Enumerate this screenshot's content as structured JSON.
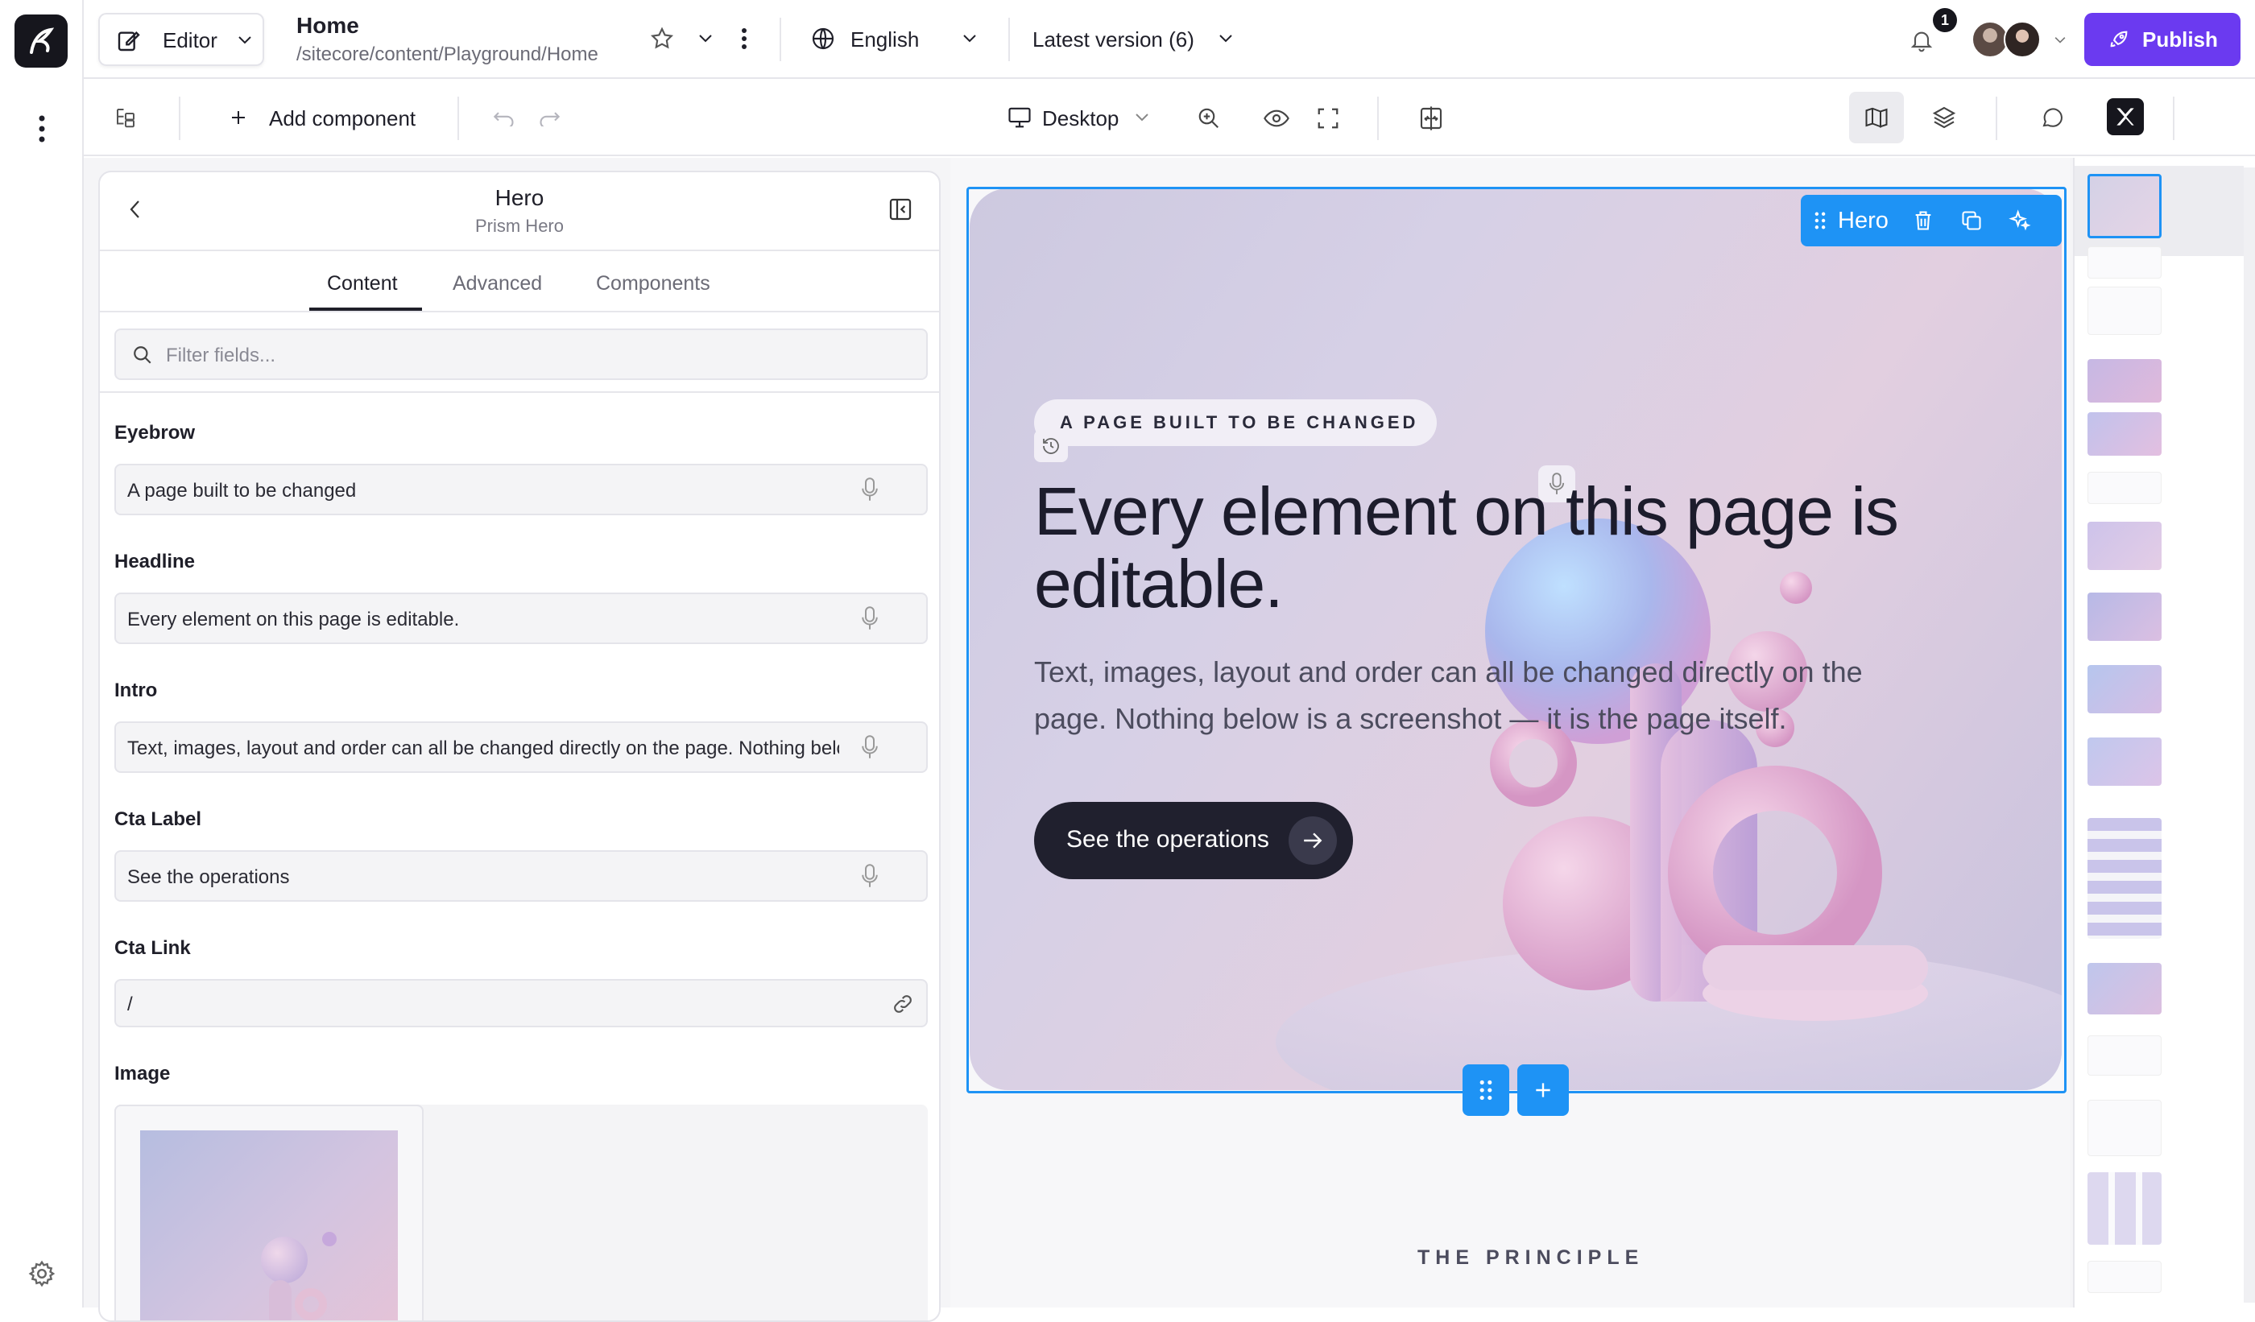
{
  "app": {
    "mode": "Editor",
    "page_title": "Home",
    "page_path": "/sitecore/content/Playground/Home",
    "language": "English",
    "version": "Latest version (6)",
    "notification_count": "1",
    "publish_label": "Publish",
    "accent_color": "#6b3af0"
  },
  "toolbar": {
    "add_component": "Add component",
    "device": "Desktop"
  },
  "panel": {
    "title": "Hero",
    "subtitle": "Prism Hero",
    "tabs": [
      "Content",
      "Advanced",
      "Components"
    ],
    "active_tab": "Content",
    "filter_placeholder": "Filter fields...",
    "fields": {
      "eyebrow_label": "Eyebrow",
      "eyebrow_value": "A page built to be changed",
      "headline_label": "Headline",
      "headline_value": "Every element on this page is editable.",
      "intro_label": "Intro",
      "intro_value": "Text, images, layout and order can all be changed directly on the page. Nothing below is a screenshot — it is the page itself.",
      "cta_label_label": "Cta Label",
      "cta_label_value": "See the operations",
      "cta_link_label": "Cta Link",
      "cta_link_value": "/",
      "image_label": "Image"
    }
  },
  "hero": {
    "chip_label": "Hero",
    "eyebrow": "A PAGE BUILT TO BE CHANGED",
    "headline": "Every element on this page is editable.",
    "intro": "Text, images, layout and order can all be changed directly on the page. Nothing below is a screenshot — it is the page itself.",
    "cta": "See the operations",
    "selection_color": "#1e93f5"
  },
  "next_section": {
    "eyebrow": "THE PRINCIPLE"
  }
}
